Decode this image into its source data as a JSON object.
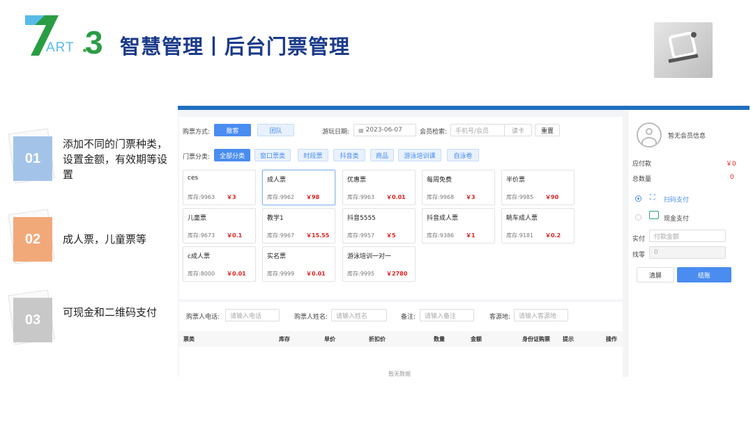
{
  "header": {
    "art_label": "ART",
    "part_number": "3",
    "title": "智慧管理丨后台门票管理"
  },
  "features": [
    {
      "num": "01",
      "text": "添加不同的门票种类，设置金额，有效期等设置",
      "color": "#a3c4e8"
    },
    {
      "num": "02",
      "text": "成人票，儿童票等",
      "color": "#f2a97a"
    },
    {
      "num": "03",
      "text": "可现金和二维码支付",
      "color": "#c8c8c8"
    }
  ],
  "app": {
    "purchase_mode_label": "购票方式:",
    "mode_single": "散客",
    "mode_group": "团队",
    "visit_date_label": "游玩日期:",
    "visit_date_value": "2023-06-07",
    "member_label": "会员检索:",
    "member_placeholder": "手机号/会员",
    "member_button": "读卡",
    "reset_button": "重置",
    "category_label": "门票分类:",
    "categories": [
      "全部分类",
      "窗口票类",
      "时段票",
      "抖音类",
      "商品",
      "游泳培训课",
      "自泳卷"
    ],
    "tickets": [
      {
        "name": "ces",
        "stock": "库存:9963",
        "price": "￥3"
      },
      {
        "name": "成人票",
        "stock": "库存:9962",
        "price": "￥98"
      },
      {
        "name": "优惠票",
        "stock": "库存:9963",
        "price": "￥0.01"
      },
      {
        "name": "每周免费",
        "stock": "库存:9968",
        "price": "￥3"
      },
      {
        "name": "半价票",
        "stock": "库存:9985",
        "price": "￥90"
      },
      {
        "name": "儿童票",
        "stock": "库存:9673",
        "price": "￥0.1"
      },
      {
        "name": "教学1",
        "stock": "库存:9967",
        "price": "￥15.55"
      },
      {
        "name": "抖音5555",
        "stock": "库存:9957",
        "price": "￥5"
      },
      {
        "name": "抖音成人票",
        "stock": "库存:9386",
        "price": "￥1"
      },
      {
        "name": "眺车成人票",
        "stock": "库存:9181",
        "price": "￥0.2"
      },
      {
        "name": "c成人票",
        "stock": "库存:8000",
        "price": "￥0.01"
      },
      {
        "name": "实名票",
        "stock": "库存:9999",
        "price": "￥0.01"
      },
      {
        "name": "游泳培训一对一",
        "stock": "库存:9995",
        "price": "￥2780"
      }
    ],
    "buyer_phone_label": "购票人电话:",
    "buyer_phone_placeholder": "请输入电话",
    "buyer_name_label": "购票人姓名:",
    "buyer_name_placeholder": "请输入姓名",
    "remark_label": "备注:",
    "remark_placeholder": "请输入备注",
    "source_label": "客源地:",
    "source_placeholder": "请输入客源地",
    "table_headers": [
      "票类",
      "库存",
      "单价",
      "折扣价",
      "数量",
      "金额",
      "身份证购票",
      "提示",
      "操作"
    ],
    "empty_text": "暂无数据",
    "sidebar": {
      "member_info": "暂无会员信息",
      "payable_label": "应付款",
      "payable_value": "￥0",
      "total_qty_label": "总数量",
      "total_qty_value": "0",
      "pay_scan": "扫码支付",
      "pay_cash": "现金支付",
      "paid_label": "实付",
      "paid_placeholder": "付款金额",
      "change_label": "找零",
      "change_value": "0",
      "clear_button": "清屏",
      "checkout_button": "结账"
    }
  },
  "colors": {
    "title": "#1a3a8a",
    "part_number": "#2a9d44",
    "primary": "#4a8cf0",
    "price": "#e02020"
  }
}
